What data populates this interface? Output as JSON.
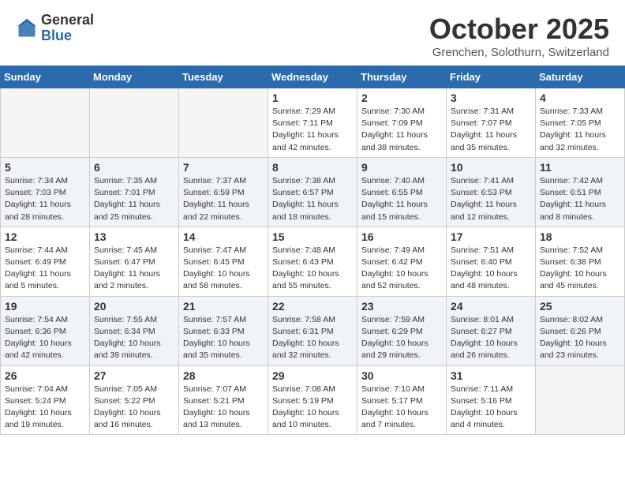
{
  "header": {
    "logo_general": "General",
    "logo_blue": "Blue",
    "month_title": "October 2025",
    "location": "Grenchen, Solothurn, Switzerland"
  },
  "days_of_week": [
    "Sunday",
    "Monday",
    "Tuesday",
    "Wednesday",
    "Thursday",
    "Friday",
    "Saturday"
  ],
  "weeks": [
    [
      {
        "day": "",
        "empty": true
      },
      {
        "day": "",
        "empty": true
      },
      {
        "day": "",
        "empty": true
      },
      {
        "day": "1",
        "sunrise": "Sunrise: 7:29 AM",
        "sunset": "Sunset: 7:11 PM",
        "daylight": "Daylight: 11 hours and 42 minutes."
      },
      {
        "day": "2",
        "sunrise": "Sunrise: 7:30 AM",
        "sunset": "Sunset: 7:09 PM",
        "daylight": "Daylight: 11 hours and 38 minutes."
      },
      {
        "day": "3",
        "sunrise": "Sunrise: 7:31 AM",
        "sunset": "Sunset: 7:07 PM",
        "daylight": "Daylight: 11 hours and 35 minutes."
      },
      {
        "day": "4",
        "sunrise": "Sunrise: 7:33 AM",
        "sunset": "Sunset: 7:05 PM",
        "daylight": "Daylight: 11 hours and 32 minutes."
      }
    ],
    [
      {
        "day": "5",
        "sunrise": "Sunrise: 7:34 AM",
        "sunset": "Sunset: 7:03 PM",
        "daylight": "Daylight: 11 hours and 28 minutes."
      },
      {
        "day": "6",
        "sunrise": "Sunrise: 7:35 AM",
        "sunset": "Sunset: 7:01 PM",
        "daylight": "Daylight: 11 hours and 25 minutes."
      },
      {
        "day": "7",
        "sunrise": "Sunrise: 7:37 AM",
        "sunset": "Sunset: 6:59 PM",
        "daylight": "Daylight: 11 hours and 22 minutes."
      },
      {
        "day": "8",
        "sunrise": "Sunrise: 7:38 AM",
        "sunset": "Sunset: 6:57 PM",
        "daylight": "Daylight: 11 hours and 18 minutes."
      },
      {
        "day": "9",
        "sunrise": "Sunrise: 7:40 AM",
        "sunset": "Sunset: 6:55 PM",
        "daylight": "Daylight: 11 hours and 15 minutes."
      },
      {
        "day": "10",
        "sunrise": "Sunrise: 7:41 AM",
        "sunset": "Sunset: 6:53 PM",
        "daylight": "Daylight: 11 hours and 12 minutes."
      },
      {
        "day": "11",
        "sunrise": "Sunrise: 7:42 AM",
        "sunset": "Sunset: 6:51 PM",
        "daylight": "Daylight: 11 hours and 8 minutes."
      }
    ],
    [
      {
        "day": "12",
        "sunrise": "Sunrise: 7:44 AM",
        "sunset": "Sunset: 6:49 PM",
        "daylight": "Daylight: 11 hours and 5 minutes."
      },
      {
        "day": "13",
        "sunrise": "Sunrise: 7:45 AM",
        "sunset": "Sunset: 6:47 PM",
        "daylight": "Daylight: 11 hours and 2 minutes."
      },
      {
        "day": "14",
        "sunrise": "Sunrise: 7:47 AM",
        "sunset": "Sunset: 6:45 PM",
        "daylight": "Daylight: 10 hours and 58 minutes."
      },
      {
        "day": "15",
        "sunrise": "Sunrise: 7:48 AM",
        "sunset": "Sunset: 6:43 PM",
        "daylight": "Daylight: 10 hours and 55 minutes."
      },
      {
        "day": "16",
        "sunrise": "Sunrise: 7:49 AM",
        "sunset": "Sunset: 6:42 PM",
        "daylight": "Daylight: 10 hours and 52 minutes."
      },
      {
        "day": "17",
        "sunrise": "Sunrise: 7:51 AM",
        "sunset": "Sunset: 6:40 PM",
        "daylight": "Daylight: 10 hours and 48 minutes."
      },
      {
        "day": "18",
        "sunrise": "Sunrise: 7:52 AM",
        "sunset": "Sunset: 6:38 PM",
        "daylight": "Daylight: 10 hours and 45 minutes."
      }
    ],
    [
      {
        "day": "19",
        "sunrise": "Sunrise: 7:54 AM",
        "sunset": "Sunset: 6:36 PM",
        "daylight": "Daylight: 10 hours and 42 minutes."
      },
      {
        "day": "20",
        "sunrise": "Sunrise: 7:55 AM",
        "sunset": "Sunset: 6:34 PM",
        "daylight": "Daylight: 10 hours and 39 minutes."
      },
      {
        "day": "21",
        "sunrise": "Sunrise: 7:57 AM",
        "sunset": "Sunset: 6:33 PM",
        "daylight": "Daylight: 10 hours and 35 minutes."
      },
      {
        "day": "22",
        "sunrise": "Sunrise: 7:58 AM",
        "sunset": "Sunset: 6:31 PM",
        "daylight": "Daylight: 10 hours and 32 minutes."
      },
      {
        "day": "23",
        "sunrise": "Sunrise: 7:59 AM",
        "sunset": "Sunset: 6:29 PM",
        "daylight": "Daylight: 10 hours and 29 minutes."
      },
      {
        "day": "24",
        "sunrise": "Sunrise: 8:01 AM",
        "sunset": "Sunset: 6:27 PM",
        "daylight": "Daylight: 10 hours and 26 minutes."
      },
      {
        "day": "25",
        "sunrise": "Sunrise: 8:02 AM",
        "sunset": "Sunset: 6:26 PM",
        "daylight": "Daylight: 10 hours and 23 minutes."
      }
    ],
    [
      {
        "day": "26",
        "sunrise": "Sunrise: 7:04 AM",
        "sunset": "Sunset: 5:24 PM",
        "daylight": "Daylight: 10 hours and 19 minutes."
      },
      {
        "day": "27",
        "sunrise": "Sunrise: 7:05 AM",
        "sunset": "Sunset: 5:22 PM",
        "daylight": "Daylight: 10 hours and 16 minutes."
      },
      {
        "day": "28",
        "sunrise": "Sunrise: 7:07 AM",
        "sunset": "Sunset: 5:21 PM",
        "daylight": "Daylight: 10 hours and 13 minutes."
      },
      {
        "day": "29",
        "sunrise": "Sunrise: 7:08 AM",
        "sunset": "Sunset: 5:19 PM",
        "daylight": "Daylight: 10 hours and 10 minutes."
      },
      {
        "day": "30",
        "sunrise": "Sunrise: 7:10 AM",
        "sunset": "Sunset: 5:17 PM",
        "daylight": "Daylight: 10 hours and 7 minutes."
      },
      {
        "day": "31",
        "sunrise": "Sunrise: 7:11 AM",
        "sunset": "Sunset: 5:16 PM",
        "daylight": "Daylight: 10 hours and 4 minutes."
      },
      {
        "day": "",
        "empty": true
      }
    ]
  ]
}
